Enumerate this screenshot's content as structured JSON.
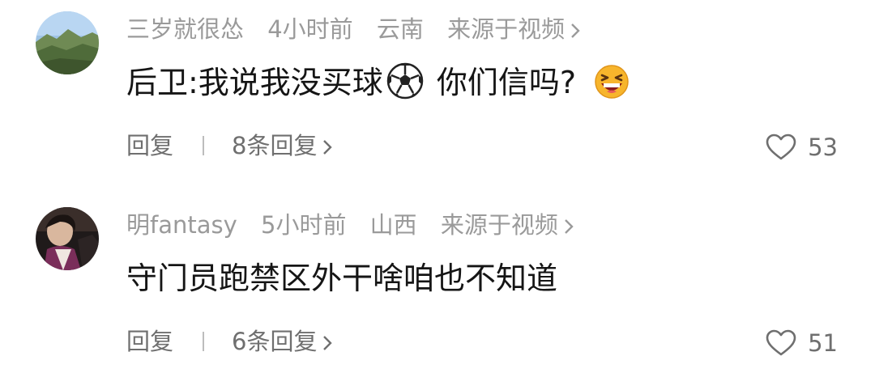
{
  "comments": [
    {
      "username": "三岁就很怂",
      "time": "4小时前",
      "location": "云南",
      "source": "来源于视频",
      "text_before": "后卫:我说我没买球",
      "text_after": " 你们信吗?",
      "emojis": [
        "soccer-ball-icon",
        "laughing-face-icon"
      ],
      "reply_label": "回复",
      "replies_label": "8条回复",
      "likes": "53"
    },
    {
      "username": "明fantasy",
      "time": "5小时前",
      "location": "山西",
      "source": "来源于视频",
      "text_before": "守门员跑禁区外干啥咱也不知道",
      "reply_label": "回复",
      "replies_label": "6条回复",
      "likes": "51"
    }
  ],
  "colors": {
    "meta": "#9a9a9a",
    "text": "#151515",
    "action": "#6f6f6f"
  }
}
